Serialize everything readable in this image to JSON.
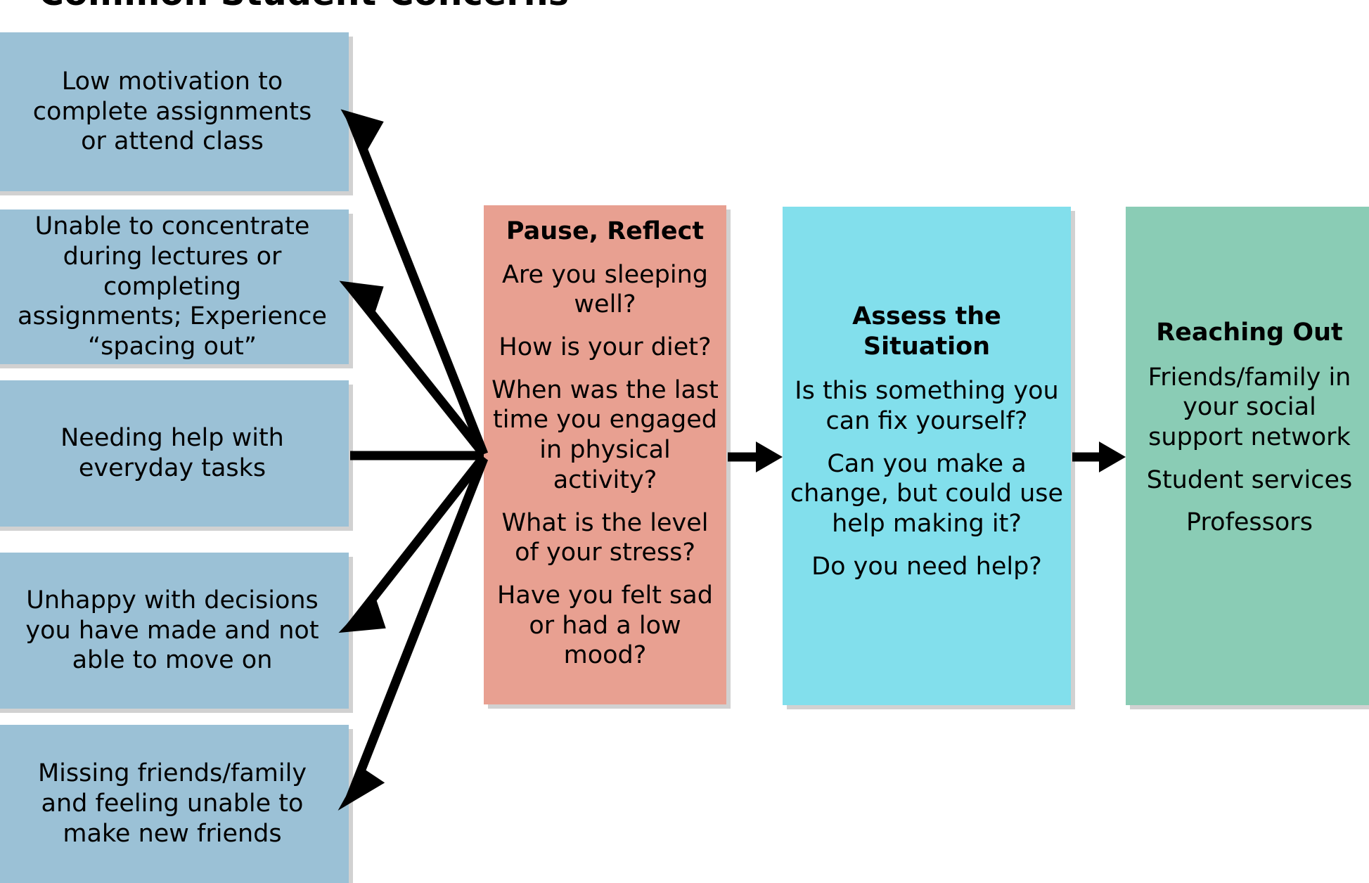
{
  "title": "Common Student Concerns",
  "colors": {
    "concern_box": "#9BC1D6",
    "pause_box": "#E8A091",
    "assess_box": "#82DFEC",
    "reaching_box": "#8ACCB5",
    "arrow": "#000000",
    "background": "#FFFFFF",
    "text": "#000000"
  },
  "concerns": [
    {
      "id": "low-motivation",
      "text": "Low motivation to complete assignments or attend class"
    },
    {
      "id": "unable-concentrate",
      "text": "Unable to concentrate during lectures or completing assignments; Experience “spacing out”"
    },
    {
      "id": "needing-help",
      "text": "Needing help with everyday tasks"
    },
    {
      "id": "unhappy-decisions",
      "text": "Unhappy with decisions you have made and not able to move on"
    },
    {
      "id": "missing-friends",
      "text": "Missing friends/family and feeling unable to make new friends"
    }
  ],
  "stages": [
    {
      "id": "pause-reflect",
      "title": "Pause, Reflect",
      "lines": [
        "Are you sleeping well?",
        "How is your diet?",
        "When was the last time you engaged in physical activity?",
        "What is the level of your stress?",
        "Have you felt sad or had a low mood?"
      ]
    },
    {
      "id": "assess-situation",
      "title": "Assess the Situation",
      "lines": [
        "Is this something you can fix yourself?",
        "Can you make a change, but could use help making it?",
        "Do you need help?"
      ]
    },
    {
      "id": "reaching-out",
      "title": "Reaching Out",
      "lines": [
        "Friends/family in your social support network",
        "Student services",
        "Professors"
      ]
    }
  ],
  "arrows": [
    {
      "id": "concern-1-to-pause",
      "from": "low-motivation",
      "to": "pause-reflect"
    },
    {
      "id": "concern-2-to-pause",
      "from": "unable-concentrate",
      "to": "pause-reflect"
    },
    {
      "id": "concern-3-to-pause",
      "from": "needing-help",
      "to": "pause-reflect"
    },
    {
      "id": "concern-4-to-pause",
      "from": "unhappy-decisions",
      "to": "pause-reflect"
    },
    {
      "id": "concern-5-to-pause",
      "from": "missing-friends",
      "to": "pause-reflect"
    },
    {
      "id": "pause-to-assess",
      "from": "pause-reflect",
      "to": "assess-situation"
    },
    {
      "id": "assess-to-reaching",
      "from": "assess-situation",
      "to": "reaching-out"
    }
  ]
}
